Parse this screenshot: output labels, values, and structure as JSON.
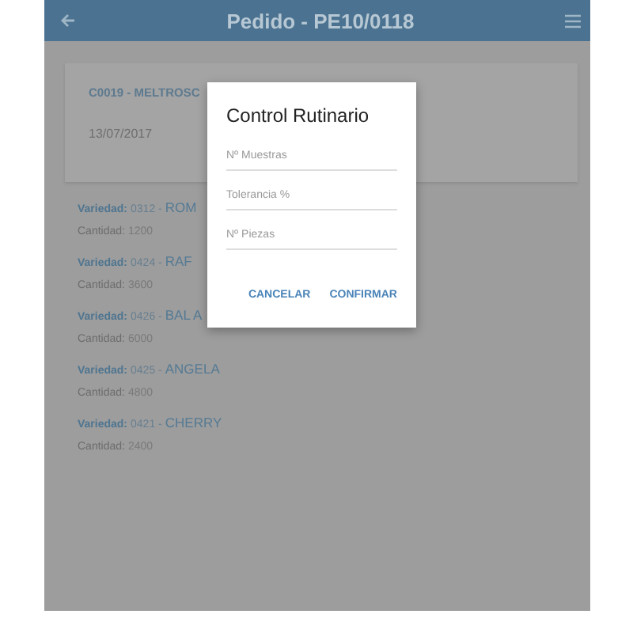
{
  "header": {
    "title": "Pedido - PE10/0118"
  },
  "card": {
    "code": "C0019 - MELTROSC",
    "date": "13/07/2017"
  },
  "varieties": [
    {
      "variety_label": "Variedad:",
      "code": "0312 -",
      "name": "ROM",
      "quantity_label": "Cantidad:",
      "quantity": "1200"
    },
    {
      "variety_label": "Variedad:",
      "code": "0424 -",
      "name": "RAF",
      "quantity_label": "Cantidad:",
      "quantity": "3600"
    },
    {
      "variety_label": "Variedad:",
      "code": "0426 -",
      "name": "BAL A",
      "quantity_label": "Cantidad:",
      "quantity": "6000"
    },
    {
      "variety_label": "Variedad:",
      "code": "0425 -",
      "name": "ANGELA",
      "quantity_label": "Cantidad:",
      "quantity": "4800"
    },
    {
      "variety_label": "Variedad:",
      "code": "0421 -",
      "name": "CHERRY",
      "quantity_label": "Cantidad:",
      "quantity": "2400"
    }
  ],
  "dialog": {
    "title": "Control Rutinario",
    "fields": [
      {
        "placeholder": "Nº Muestras"
      },
      {
        "placeholder": "Tolerancia %"
      },
      {
        "placeholder": "Nº Piezas"
      }
    ],
    "buttons": [
      "CANCELAR",
      "CONFIRMAR"
    ]
  }
}
